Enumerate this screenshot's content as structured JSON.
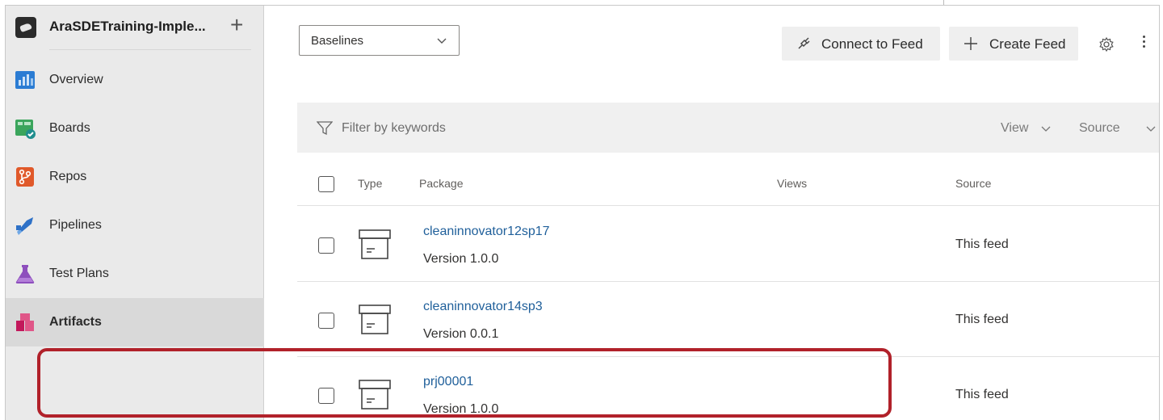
{
  "project": {
    "name": "AraSDETraining-Imple...",
    "add_icon": "plus-icon"
  },
  "nav": {
    "items": [
      {
        "label": "Overview",
        "icon": "overview-icon",
        "color": "#2b7cd3"
      },
      {
        "label": "Boards",
        "icon": "boards-icon",
        "color": "#3ba55c"
      },
      {
        "label": "Repos",
        "icon": "repos-icon",
        "color": "#e0592a"
      },
      {
        "label": "Pipelines",
        "icon": "pipelines-icon",
        "color": "#2e71c7"
      },
      {
        "label": "Test Plans",
        "icon": "test-plans-icon",
        "color": "#8e4fbd"
      },
      {
        "label": "Artifacts",
        "icon": "artifacts-icon",
        "color": "#c2185b",
        "active": true
      }
    ]
  },
  "toolbar": {
    "feed_selector": "Baselines",
    "connect_label": "Connect to Feed",
    "create_label": "Create Feed",
    "settings_icon": "gear-icon",
    "more_icon": "more-vertical-icon"
  },
  "filter": {
    "placeholder": "Filter by keywords",
    "view_label": "View",
    "source_label": "Source"
  },
  "table": {
    "columns": [
      "Type",
      "Package",
      "Views",
      "Source"
    ],
    "rows": [
      {
        "name": "cleaninnovator12sp17",
        "version": "Version 1.0.0",
        "source": "This feed"
      },
      {
        "name": "cleaninnovator14sp3",
        "version": "Version 0.0.1",
        "source": "This feed"
      },
      {
        "name": "prj00001",
        "version": "Version 1.0.0",
        "source": "This feed",
        "highlighted": true
      }
    ]
  },
  "colors": {
    "accent_link": "#1f5f9a",
    "highlight_border": "#b1212a",
    "sidebar_bg": "#eaeaea"
  }
}
